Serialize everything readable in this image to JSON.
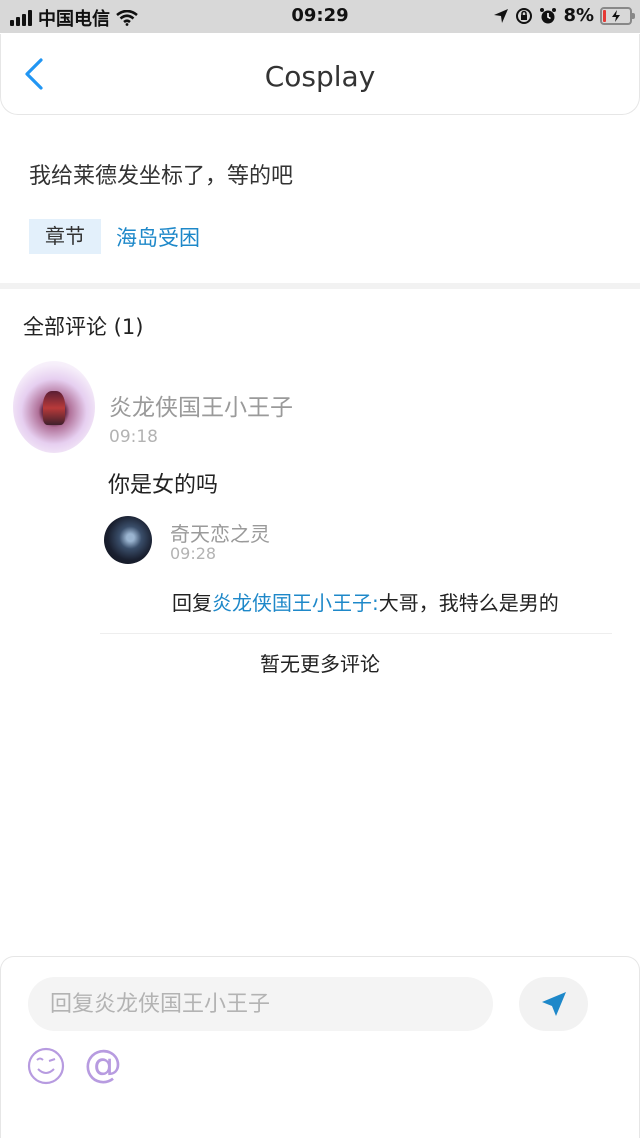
{
  "status_bar": {
    "carrier": "中国电信",
    "time": "09:29",
    "battery": "8%",
    "icons": [
      "signal-icon",
      "wifi-icon",
      "location-icon",
      "lock-rotation-icon",
      "alarm-icon",
      "battery-icon"
    ]
  },
  "navbar": {
    "title": "Cosplay",
    "back_icon": "chevron-left-icon"
  },
  "post": {
    "text": "我给莱德发坐标了，等的吧",
    "chapter_label": "章节",
    "chapter_link": "海岛受困"
  },
  "comments": {
    "header": "全部评论 (1)",
    "items": [
      {
        "author": "炎龙侠国王小王子",
        "time": "09:18",
        "text": "你是女的吗",
        "replies": [
          {
            "author": "奇天恋之灵",
            "time": "09:28",
            "reply_prefix": "回复",
            "reply_to": "炎龙侠国王小王子:",
            "text": "大哥，我特么是男的"
          }
        ]
      }
    ],
    "no_more": "暂无更多评论"
  },
  "input": {
    "placeholder": "回复炎龙侠国王小王子",
    "send_icon": "send-icon",
    "emoji_icon": "emoji-icon",
    "at_label": "@"
  },
  "colors": {
    "accent": "#1e88c9",
    "tag_bg": "#e3f0fb",
    "icon_purple": "#b79be0",
    "battery_low": "#e53935"
  }
}
